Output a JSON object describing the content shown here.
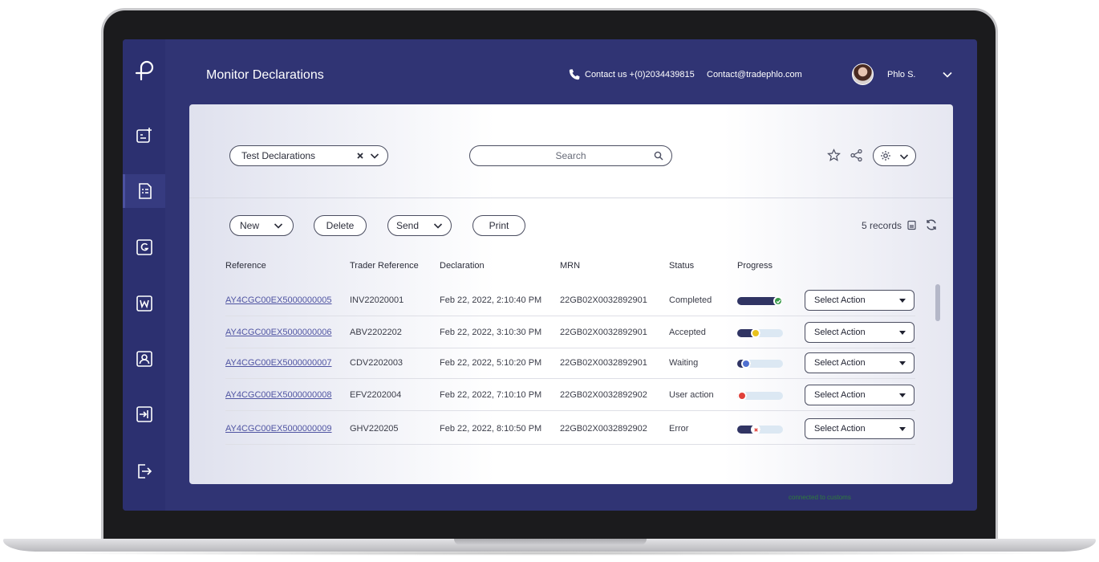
{
  "header": {
    "title": "Monitor Declarations",
    "phone": "Contact us +(0)2034439815",
    "email": "Contact@tradephlo.com",
    "user_name": "Phlo S."
  },
  "sidebar": {
    "items": [
      {
        "icon": "add-document-icon"
      },
      {
        "icon": "declarations-list-icon",
        "active": true
      },
      {
        "icon": "g-box-icon"
      },
      {
        "icon": "w-box-icon"
      },
      {
        "icon": "contact-box-icon"
      },
      {
        "icon": "import-box-icon"
      },
      {
        "icon": "logout-icon"
      }
    ]
  },
  "filters": {
    "selected_filter": "Test Declarations",
    "search_placeholder": "Search"
  },
  "toolbar": {
    "new_label": "New",
    "delete_label": "Delete",
    "send_label": "Send",
    "print_label": "Print",
    "records": "5 records"
  },
  "table": {
    "columns": [
      "Reference",
      "Trader Reference",
      "Declaration",
      "MRN",
      "Status",
      "Progress"
    ],
    "rows": [
      {
        "reference": "AY4CGC00EX5000000005",
        "trader": "INV22020001",
        "declaration": "Feb 22, 2022, 2:10:40 PM",
        "mrn": "22GB02X0032892901",
        "status": "Completed",
        "progress": 1.0,
        "dot_color": "#3a9a4a",
        "action": "Select Action"
      },
      {
        "reference": "AY4CGC00EX5000000006",
        "trader": "ABV2202202",
        "declaration": "Feb 22, 2022, 3:10:30 PM",
        "mrn": "22GB02X0032892901",
        "status": "Accepted",
        "progress": 0.5,
        "dot_color": "#e8c21c",
        "action": "Select Action"
      },
      {
        "reference": "AY4CGC00EX5000000007",
        "trader": "CDV2202003",
        "declaration": "Feb 22, 2022, 5:10:20 PM",
        "mrn": "22GB02X0032892901",
        "status": "Waiting",
        "progress": 0.3,
        "dot_color": "#4f6fd0",
        "action": "Select Action"
      },
      {
        "reference": "AY4CGC00EX5000000008",
        "trader": "EFV2202004",
        "declaration": "Feb 22, 2022, 7:10:10 PM",
        "mrn": "22GB02X0032892902",
        "status": "User action",
        "progress": 0.2,
        "dot_color": "#e0403a",
        "action": "Select Action"
      },
      {
        "reference": "AY4CGC00EX5000000009",
        "trader": "GHV220205",
        "declaration": "Feb 22, 2022, 8:10:50 PM",
        "mrn": "22GB02X0032892902",
        "status": "Error",
        "progress": 0.5,
        "dot_color": "#ffffff",
        "action": "Select Action"
      }
    ]
  },
  "footer": {
    "connection_status": "connected to customs"
  }
}
